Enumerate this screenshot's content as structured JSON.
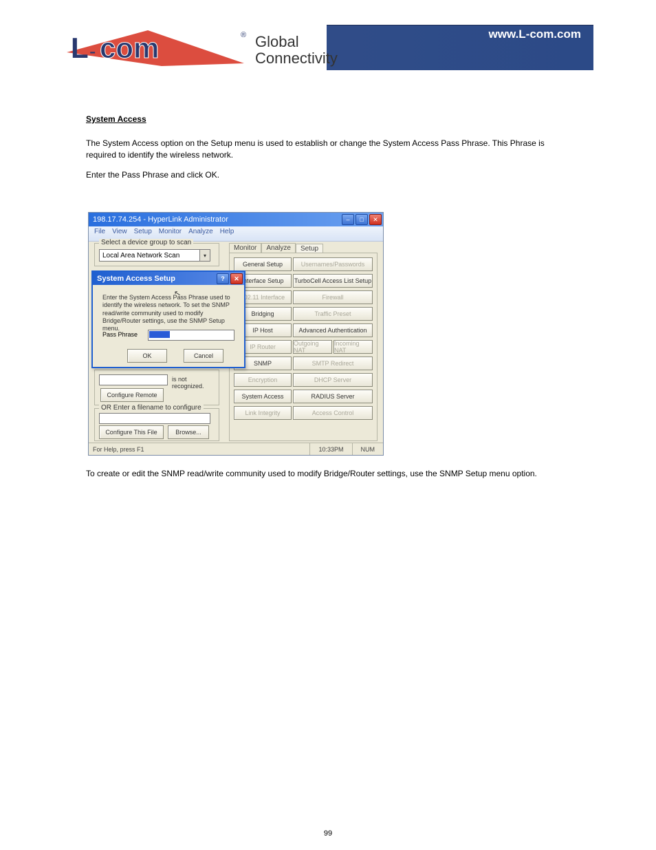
{
  "header": {
    "url": "www.L-com.com",
    "tagline1": "Global",
    "tagline2": "Connectivity"
  },
  "section_head": "System Access",
  "para1": "The System Access option on the Setup menu is used to establish or change the System Access Pass Phrase. This Phrase is required to identify the wireless network.",
  "para2": "Enter the Pass Phrase and click OK.",
  "para3": "To create or edit the SNMP read/write community used to modify Bridge/Router settings, use the SNMP Setup menu option.",
  "page_num": "99",
  "app": {
    "title": "198.17.74.254 - HyperLink Administrator",
    "menu": [
      "File",
      "View",
      "Setup",
      "Monitor",
      "Analyze",
      "Help"
    ],
    "scan_group_title": "Select a device group to scan",
    "scan_selected": "Local Area Network Scan",
    "warn_text": "is not recognized.",
    "configure_remote": "Configure Remote",
    "file_group_title": "OR Enter a filename to configure",
    "configure_file": "Configure This File",
    "browse": "Browse...",
    "tabs": {
      "monitor": "Monitor",
      "analyze": "Analyze",
      "setup": "Setup"
    },
    "buttons_a": [
      "General Setup",
      "Interface Setup",
      "802.11 Interface",
      "Bridging",
      "IP Host",
      "IP Router",
      "SNMP",
      "Encryption",
      "System Access",
      "Link Integrity"
    ],
    "buttons_b": {
      "b0": "Usernames/Passwords",
      "b1": "TurboCell Access List Setup",
      "b2": "Firewall",
      "b3": "Traffic Preset",
      "b4": "Advanced Authentication",
      "b5a": "Outgoing NAT",
      "b5b": "Incoming NAT",
      "b6": "SMTP Redirect",
      "b7": "DHCP Server",
      "b8": "RADIUS Server",
      "b9": "Access Control"
    },
    "status": {
      "help": "For Help, press F1",
      "time": "10:33PM",
      "num": "NUM"
    }
  },
  "popup": {
    "title": "System Access Setup",
    "desc": "Enter the System Access Pass Phrase used to identify the wireless network. To set the SNMP read/write community used to modify Bridge/Router settings, use the SNMP Setup menu.",
    "label": "Pass Phrase",
    "ok": "OK",
    "cancel": "Cancel"
  }
}
